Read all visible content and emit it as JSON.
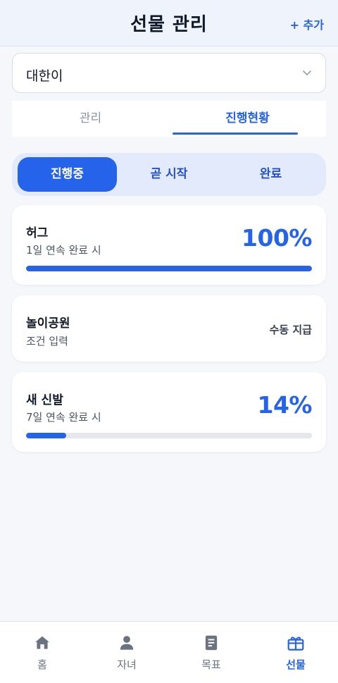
{
  "header": {
    "title": "선물 관리",
    "add_label": "+ 추가"
  },
  "child_select": {
    "value": "대한이",
    "icon": "chevron-down-icon"
  },
  "tabs": [
    {
      "label": "관리",
      "active": false
    },
    {
      "label": "진행현황",
      "active": true
    }
  ],
  "status_filter": [
    {
      "label": "진행중",
      "active": true
    },
    {
      "label": "곧 시작",
      "active": false
    },
    {
      "label": "완료",
      "active": false
    }
  ],
  "gifts": [
    {
      "title": "허그",
      "subtitle": "1일 연속 완료 시",
      "percent_label": "100%",
      "progress": 1.0
    },
    {
      "title": "놀이공원",
      "subtitle": "조건 입력",
      "status_label": "수동 지급"
    },
    {
      "title": "새 신발",
      "subtitle": "7일 연속 완료 시",
      "percent_label": "14%",
      "progress": 0.14
    }
  ],
  "bottom_nav": [
    {
      "label": "홈",
      "icon": "home-icon",
      "active": false
    },
    {
      "label": "자녀",
      "icon": "user-icon",
      "active": false
    },
    {
      "label": "목표",
      "icon": "document-icon",
      "active": false
    },
    {
      "label": "선물",
      "icon": "gift-icon",
      "active": true
    }
  ],
  "colors": {
    "accent": "#2563eb",
    "background": "#f5f7fb",
    "header_bg": "#eef3fc",
    "track": "#e5e7eb",
    "inactive_icon": "#6b7280"
  }
}
